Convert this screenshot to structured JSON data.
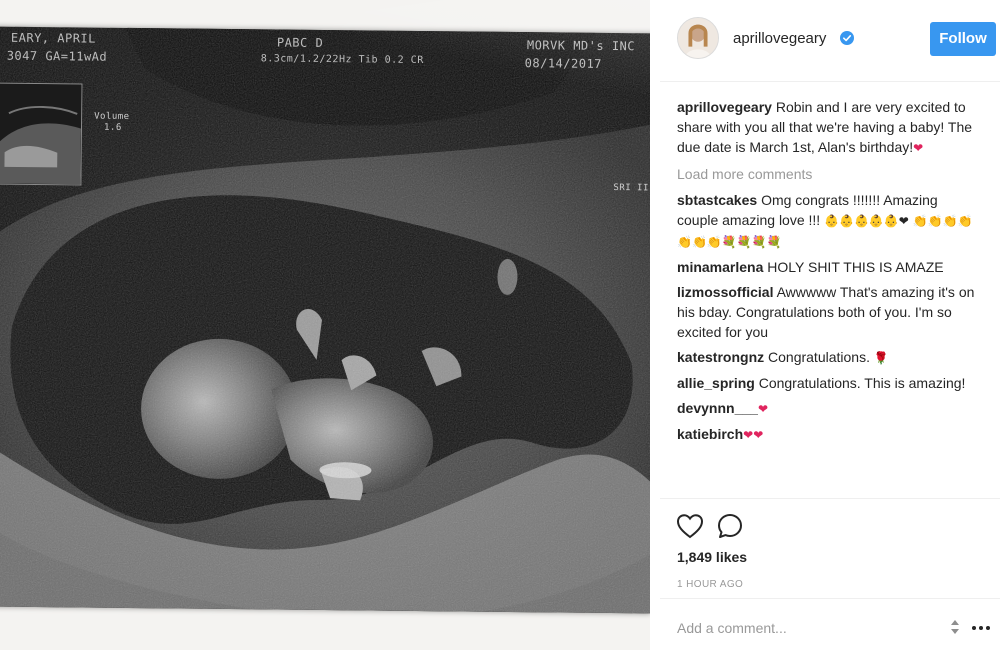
{
  "photo": {
    "header": {
      "patient": "EARY, APRIL",
      "id_ga": "3047 GA=11wAd",
      "center": "PABC D",
      "measure": "8.3cm/1.2/22Hz  Tib 0.2  CR",
      "clinic": "MORVK MD's INC",
      "date": "08/14/2017",
      "volume_label": "Volume",
      "volume_value": "1.6",
      "right_label": "SRI II"
    }
  },
  "post": {
    "username": "aprillovegeary",
    "follow_label": "Follow",
    "caption": "Robin and I are very excited to share with you all that we're having a baby! The due date is March 1st, Alan's birthday!",
    "caption_emoji": "❤",
    "load_more": "Load more comments",
    "comments": [
      {
        "user": "sbtastcakes",
        "text": "Omg congrats !!!!!!! Amazing couple amazing love !!! ",
        "emoji": "👶👶👶👶👶❤ 👏👏👏👏👏👏👏💐💐💐💐"
      },
      {
        "user": "minamarlena",
        "text": "HOLY SHIT THIS IS AMAZE",
        "emoji": ""
      },
      {
        "user": "lizmossofficial",
        "text": "Awwwww That's amazing it's on his bday. Congratulations both of you. I'm so excited for you",
        "emoji": ""
      },
      {
        "user": "katestrongnz",
        "text": "Congratulations. ",
        "emoji": "🌹"
      },
      {
        "user": "allie_spring",
        "text": "Congratulations. This is amazing!",
        "emoji": ""
      },
      {
        "user": "devynnn___",
        "text": "",
        "emoji": "❤"
      },
      {
        "user": "katiebirch",
        "text": "",
        "emoji": "❤❤"
      }
    ],
    "likes": "1,849 likes",
    "time": "1 HOUR AGO",
    "add_comment_placeholder": "Add a comment...",
    "colors": {
      "follow_bg": "#3897f0",
      "muted": "#999999",
      "text": "#262626",
      "verified": "#3897f0"
    },
    "icons": [
      "heart-icon",
      "comment-icon",
      "verified-badge-icon",
      "sort-stepper-icon",
      "more-options-icon"
    ]
  }
}
